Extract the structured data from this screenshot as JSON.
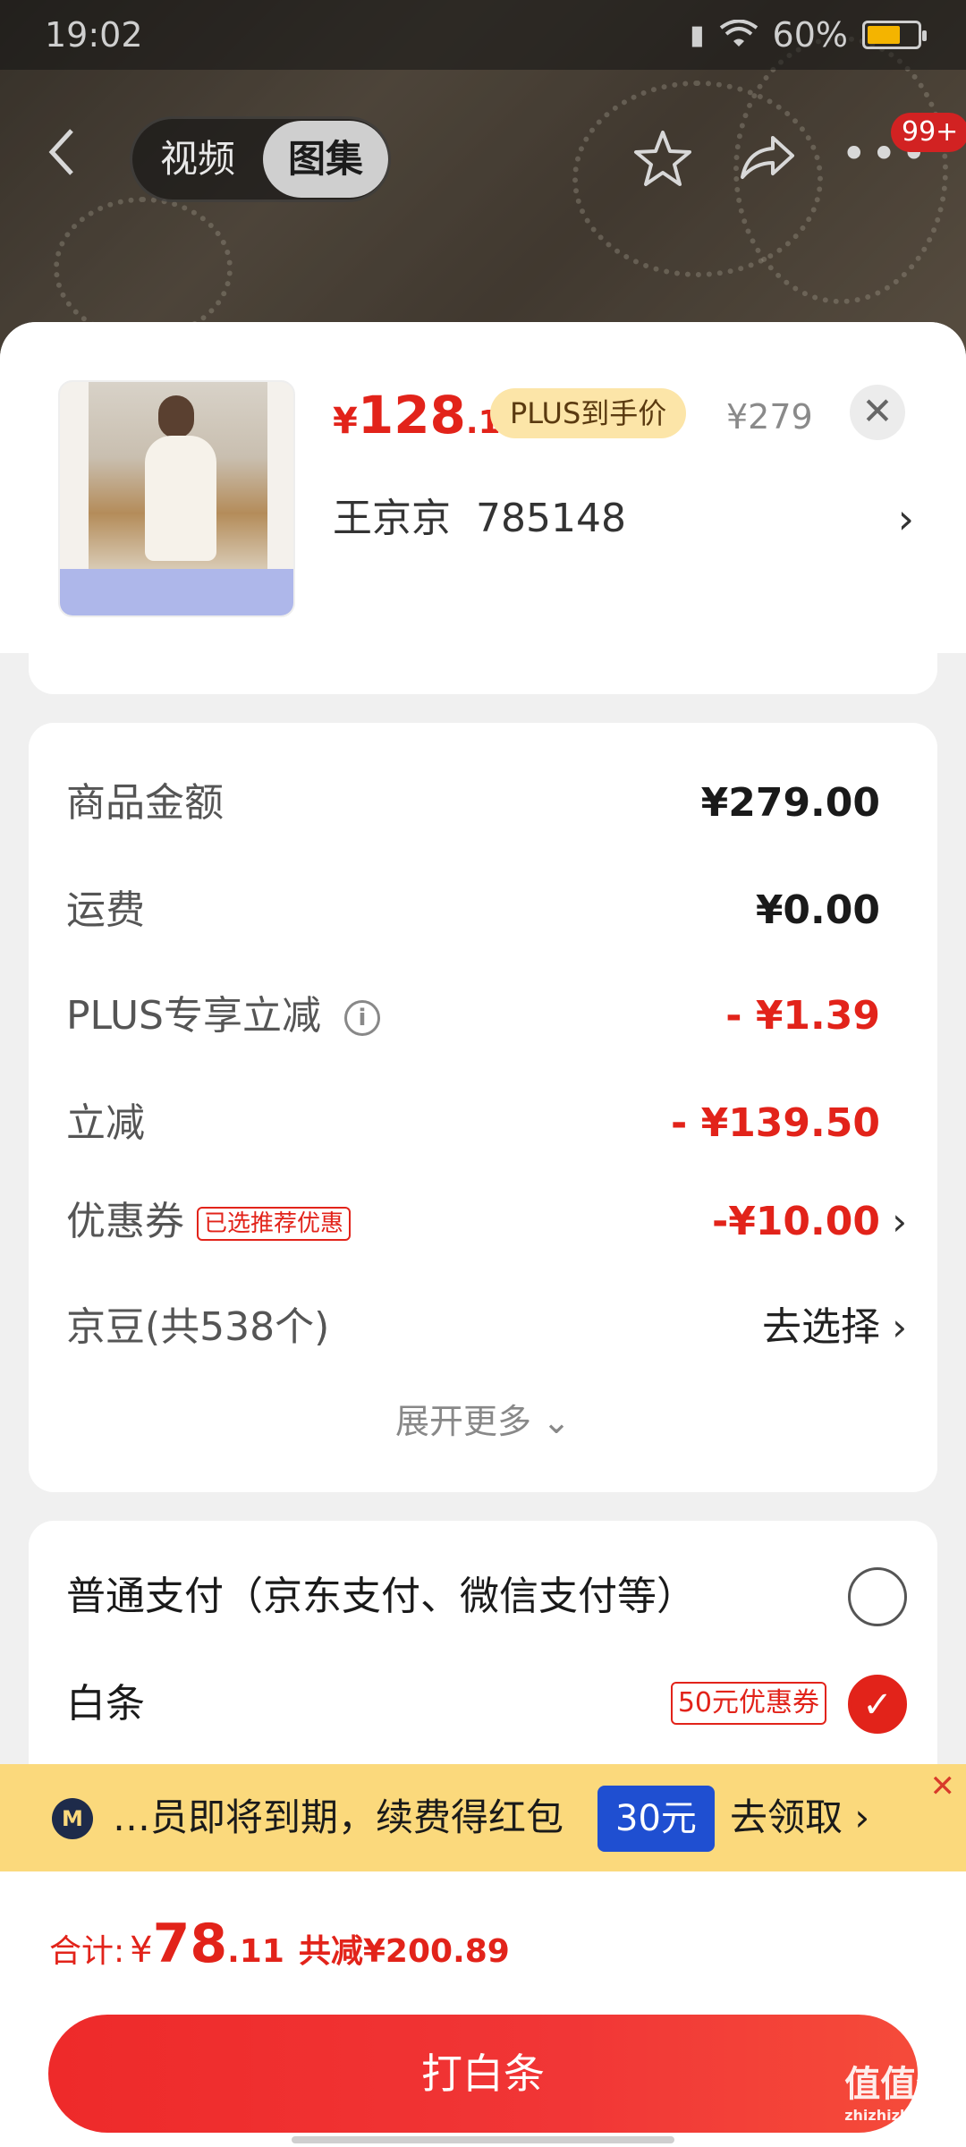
{
  "status_bar": {
    "time": "19:02",
    "battery": "60%"
  },
  "nav": {
    "tab_video": "视频",
    "tab_album": "图集",
    "badge": "99+"
  },
  "product": {
    "price_currency": "¥",
    "price_int": "128",
    "price_dec": ".11",
    "plus_tag": "PLUS到手价",
    "original_price": "¥279",
    "seller": "王京京  785148"
  },
  "details": {
    "rows": [
      {
        "label": "商品金额",
        "value": "¥279.00"
      },
      {
        "label": "运费",
        "value": "¥0.00"
      },
      {
        "label": "PLUS专享立减",
        "value": "- ¥1.39"
      },
      {
        "label": "立减",
        "value": "- ¥139.50"
      },
      {
        "label": "优惠券",
        "tag": "已选推荐优惠",
        "value": "-¥10.00"
      },
      {
        "label": "京豆(共538个)",
        "value": "去选择"
      }
    ],
    "expand": "展开更多"
  },
  "payment": {
    "options": [
      {
        "label": "普通支付（京东支付、微信支付等）",
        "selected": false
      },
      {
        "label": "白条",
        "tag": "50元优惠券",
        "selected": true
      }
    ]
  },
  "promo": {
    "text": "…员即将到期，续费得红包",
    "amount": "30元",
    "action": "去领取"
  },
  "total": {
    "label": "合计:",
    "currency": "¥",
    "int": "78",
    "dec": ".11",
    "saved": "共减¥200.89"
  },
  "pay_button": "打白条",
  "watermark": {
    "main": "值值值",
    "sub": "zhizhizhi.com"
  },
  "colors": {
    "accent": "#e2231a",
    "plus_tag_bg": "#fce5a8",
    "promo_bg": "#fbd97c",
    "promo_amount_bg": "#1f4fd1"
  }
}
